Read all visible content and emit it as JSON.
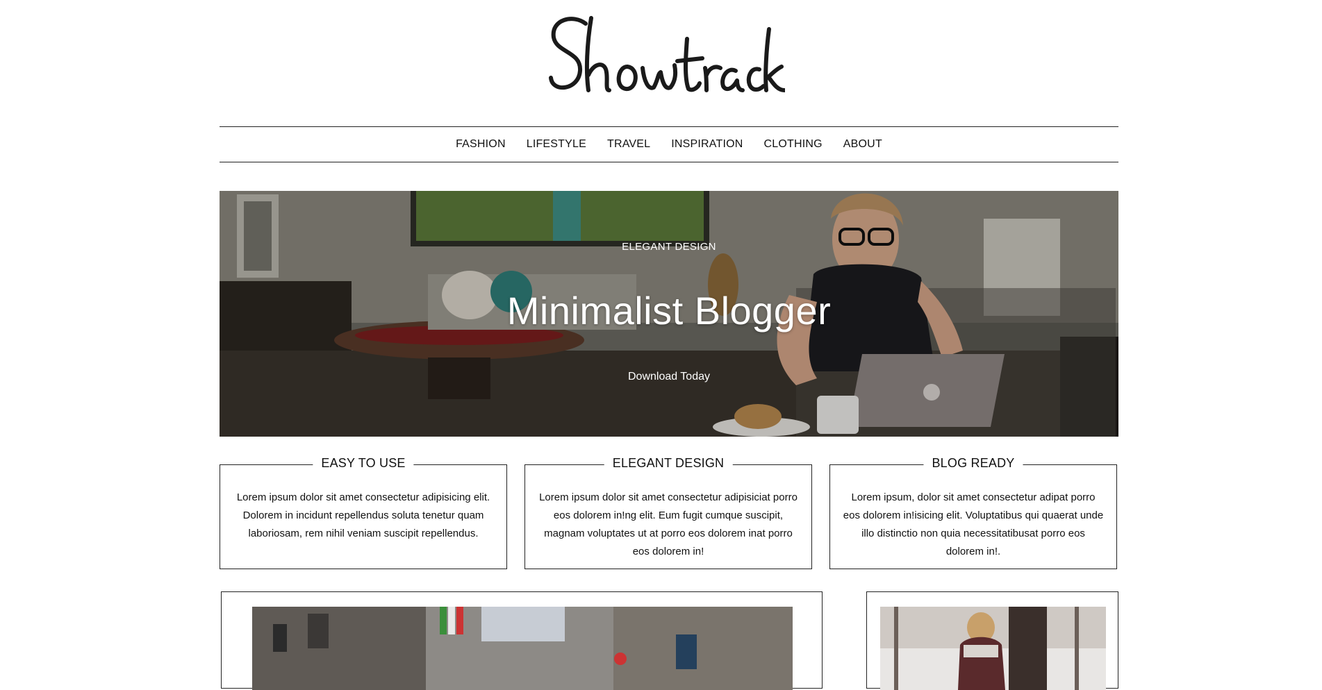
{
  "site": {
    "logo_text": "Showtrack"
  },
  "nav": {
    "items": [
      {
        "label": "FASHION"
      },
      {
        "label": "LIFESTYLE"
      },
      {
        "label": "TRAVEL"
      },
      {
        "label": "INSPIRATION"
      },
      {
        "label": "CLOTHING"
      },
      {
        "label": "ABOUT"
      }
    ]
  },
  "hero": {
    "kicker": "ELEGANT DESIGN",
    "title": "Minimalist Blogger",
    "cta": "Download Today",
    "image_icon": "photo-woman-laptop"
  },
  "features": [
    {
      "title": "EASY TO USE",
      "text": "Lorem ipsum dolor sit amet consectetur adipisicing elit. Dolorem in incidunt repellendus soluta tenetur quam laboriosam, rem nihil veniam suscipit repellendus."
    },
    {
      "title": "ELEGANT DESIGN",
      "text": "Lorem ipsum dolor sit amet consectetur adipisiciat porro eos dolorem in!ng elit. Eum fugit cumque suscipit, magnam voluptates ut at porro eos dolorem inat porro eos dolorem in!"
    },
    {
      "title": "BLOG READY",
      "text": "Lorem ipsum, dolor sit amet consectetur adipat porro eos dolorem in!isicing elit. Voluptatibus qui quaerat unde illo distinctio non quia necessitatibusat porro eos dolorem in!."
    }
  ],
  "posts": [
    {
      "image_icon": "photo-city-street"
    },
    {
      "image_icon": "photo-woman-winter"
    }
  ],
  "colors": {
    "text": "#111111",
    "border": "#222222",
    "background": "#ffffff"
  }
}
